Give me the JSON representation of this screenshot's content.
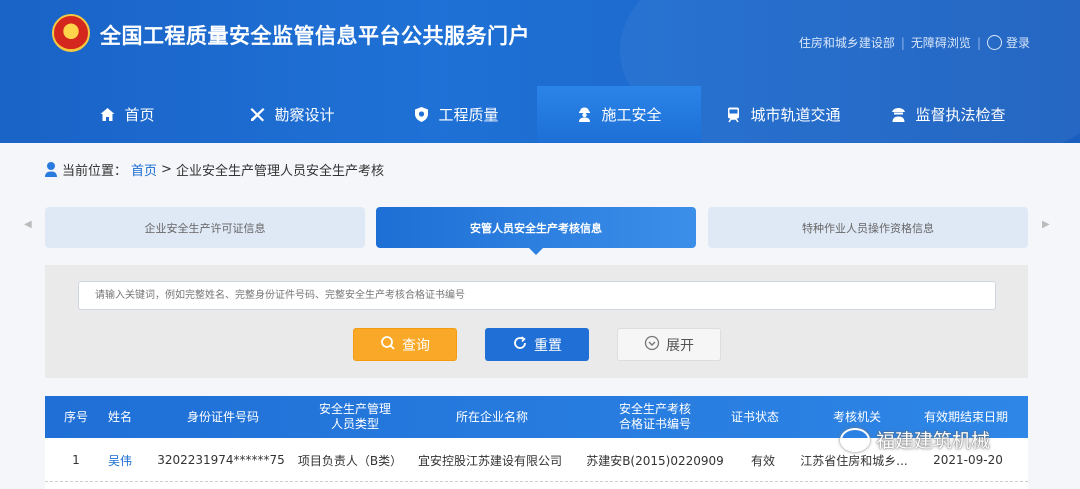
{
  "header": {
    "site_title": "全国工程质量安全监管信息平台公共服务门户",
    "links": [
      "住房和城乡建设部",
      "无障碍浏览",
      "登录"
    ]
  },
  "nav": {
    "items": [
      {
        "label": "首页",
        "icon": "home-icon"
      },
      {
        "label": "勘察设计",
        "icon": "tools-icon"
      },
      {
        "label": "工程质量",
        "icon": "shield-icon"
      },
      {
        "label": "施工安全",
        "icon": "worker-icon",
        "active": true
      },
      {
        "label": "城市轨道交通",
        "icon": "train-icon"
      },
      {
        "label": "监督执法检查",
        "icon": "officer-icon"
      }
    ]
  },
  "breadcrumb": {
    "prefix": "当前位置：",
    "home": "首页",
    "separator": ">",
    "current": "企业安全生产管理人员安全生产考核"
  },
  "tabs": [
    {
      "label": "企业安全生产许可证信息"
    },
    {
      "label": "安管人员安全生产考核信息",
      "active": true
    },
    {
      "label": "特种作业人员操作资格信息"
    }
  ],
  "search": {
    "placeholder": "请输入关键词，例如完整姓名、完整身份证件号码、完整安全生产考核合格证书编号",
    "search_label": "查询",
    "reset_label": "重置",
    "expand_label": "展开"
  },
  "table": {
    "headers": [
      "序号",
      "姓名",
      "身份证件号码",
      "安全生产管理\n人员类型",
      "所在企业名称",
      "安全生产考核\n合格证书编号",
      "证书状态",
      "考核机关",
      "有效期结束日期"
    ],
    "rows": [
      [
        "1",
        "吴伟",
        "3202231974******75",
        "项目负责人（B类）",
        "宜安控股江苏建设有限公司",
        "苏建安B(2015)0220909",
        "有效",
        "江苏省住房和城乡...",
        "2021-09-20"
      ]
    ]
  },
  "watermark": "福建建筑机械",
  "colors": {
    "primary": "#1f6fd6",
    "accent": "#f9a827",
    "link": "#1a6dd4"
  }
}
